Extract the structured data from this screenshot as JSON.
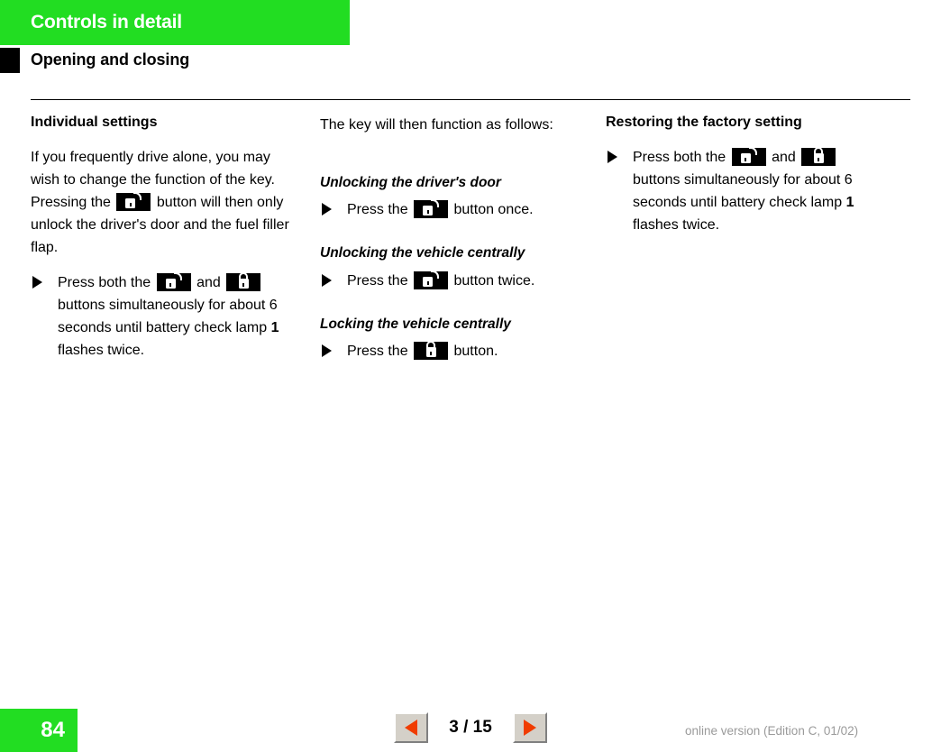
{
  "header": {
    "chapter_title": "Controls in detail",
    "section_title": "Opening and closing"
  },
  "icons": {
    "unlock": "unlock-padlock-icon",
    "lock": "lock-padlock-icon",
    "bullet": "triangle-bullet-icon",
    "prev": "prev-page-triangle-icon",
    "next": "next-page-triangle-icon"
  },
  "columns": {
    "left": {
      "heading": "Individual settings",
      "paragraph_part_1": "If you frequently drive alone, you may wish to change the function of the key. Pressing the",
      "paragraph_part_2": "button will then only unlock the driver's door and the fuel filler flap.",
      "bullet": {
        "text_part_1": "Press both the",
        "text_part_2": "and",
        "text_part_3": "buttons simultaneously for about 6 seconds until battery check lamp",
        "reference": "1",
        "text_part_4": "flashes twice."
      }
    },
    "middle": {
      "intro": "The key will then function as follows:",
      "sections": [
        {
          "subheading": "Unlocking the driver's door",
          "bullet_part_1": "Press the",
          "bullet_part_2": "button once."
        },
        {
          "subheading": "Unlocking the vehicle centrally",
          "bullet_part_1": "Press the",
          "bullet_part_2": "button twice."
        },
        {
          "subheading": "Locking the vehicle centrally",
          "bullet_part_1": "Press the",
          "bullet_part_2": "button."
        }
      ]
    },
    "right": {
      "heading": "Restoring the factory setting",
      "bullet": {
        "text_part_1": "Press both the",
        "text_part_2": "and",
        "text_part_3": "buttons simultaneously for about 6 seconds until battery check lamp",
        "reference": "1",
        "text_part_4": "flashes twice."
      }
    }
  },
  "footer": {
    "page_number": "84",
    "pager_label": "3 / 15",
    "edition_note": "online version (Edition C, 01/02)"
  },
  "colors": {
    "brand_green": "#22dd22",
    "nav_triangle": "#f03c00",
    "edition_text": "#9a9a9a"
  }
}
